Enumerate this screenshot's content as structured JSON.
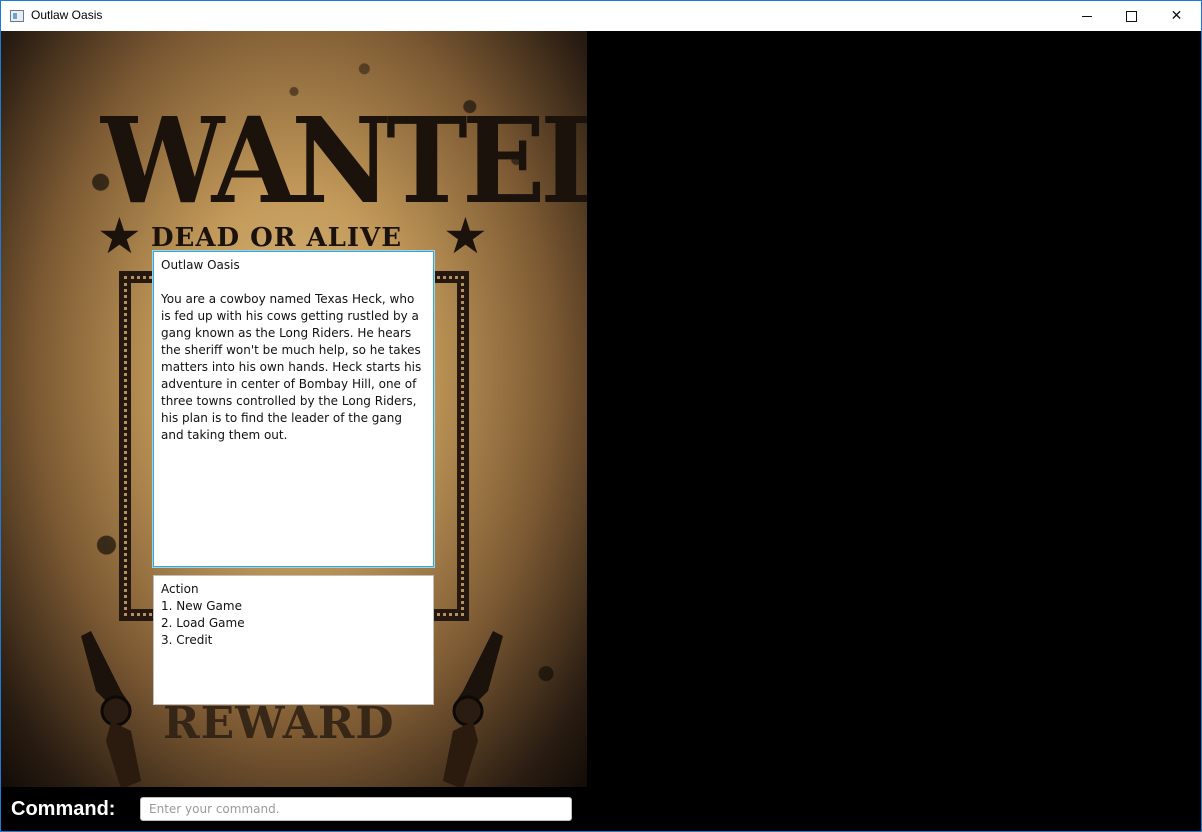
{
  "window": {
    "title": "Outlaw Oasis",
    "icon": "app-window-icon",
    "controls": {
      "minimize_icon": "minimize-icon",
      "maximize_icon": "maximize-icon",
      "close_icon": "close-icon",
      "close_glyph": "✕"
    }
  },
  "poster": {
    "headline": "WANTED",
    "subheadline": "DEAD OR ALIVE",
    "footer": "REWARD",
    "star_glyph": "★"
  },
  "story": {
    "title": "Outlaw Oasis",
    "body": "You are a cowboy named Texas Heck, who is fed up with his cows getting rustled by a gang known as the Long Riders. He hears the sheriff won't be much help, so he takes matters into his own hands. Heck starts his adventure in center of Bombay Hill, one of three towns controlled by the Long Riders, his plan is to find the leader of the gang and taking them out."
  },
  "actions": {
    "heading": "Action",
    "items": [
      "1. New Game",
      "2. Load Game",
      "3. Credit"
    ]
  },
  "command": {
    "label": "Command:",
    "placeholder": "Enter your command.",
    "value": ""
  },
  "colors": {
    "accent_border": "#3aa6d0",
    "window_border": "#1c7bd6",
    "background": "#000000"
  }
}
